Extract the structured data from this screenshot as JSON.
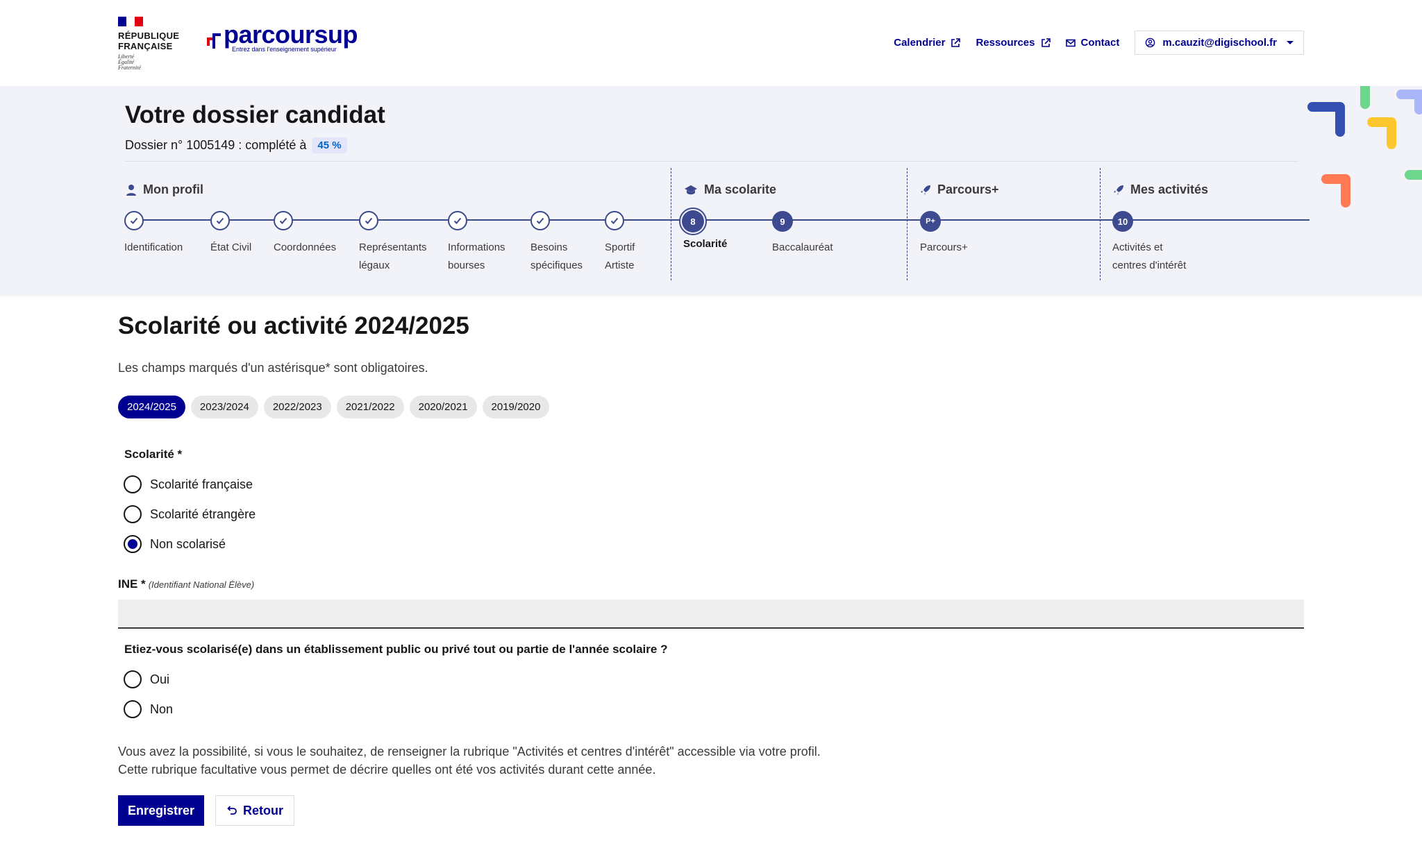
{
  "header": {
    "republique": "RÉPUBLIQUE\nFRANÇAISE",
    "devise": "Liberté\nÉgalité\nFraternité",
    "logo_word": "parcoursup",
    "logo_tagline": "Entrez dans l'enseignement supérieur",
    "nav": {
      "calendrier": "Calendrier",
      "ressources": "Ressources",
      "contact": "Contact",
      "user": "m.cauzit@digischool.fr"
    },
    "colors": {
      "brand": "#000091",
      "flag_blue": "#000091",
      "flag_red": "#e1000f"
    }
  },
  "dossier": {
    "title": "Votre dossier candidat",
    "subtitle": "Dossier n° 1005149 : complété à",
    "percent": "45 %",
    "sections": {
      "profil": "Mon profil",
      "scolarite": "Ma scolarite",
      "parcours": "Parcours+",
      "activites": "Mes activités"
    },
    "steps": {
      "identification": "Identification",
      "etat_civil": "État Civil",
      "coordonnees": "Coordonnées",
      "representants": "Représentants\nlégaux",
      "bourses": "Informations\nbourses",
      "besoins": "Besoins\nspécifiques",
      "sportif": "Sportif\nArtiste",
      "scolarite": "Scolarité",
      "scolarite_num": "8",
      "bac": "Baccalauréat",
      "bac_num": "9",
      "parcours": "Parcours+",
      "parcours_num": "P+",
      "activites": "Activités et\ncentres d'intérêt",
      "activites_num": "10"
    }
  },
  "form": {
    "title": "Scolarité ou activité 2024/2025",
    "required_note": "Les champs marqués d'un astérisque* sont obligatoires.",
    "years": [
      "2024/2025",
      "2023/2024",
      "2022/2023",
      "2021/2022",
      "2020/2021",
      "2019/2020"
    ],
    "scolarite_label": "Scolarité *",
    "scolarite_options": [
      "Scolarité française",
      "Scolarité étrangère",
      "Non scolarisé"
    ],
    "ine_label": "INE *",
    "ine_hint": "(Identifiant National Élève)",
    "ine_value": "",
    "etab_question": "Etiez-vous scolarisé(e) dans un établissement public ou privé tout ou partie de l'année scolaire ?",
    "etab_options": [
      "Oui",
      "Non"
    ],
    "info_line1": "Vous avez la possibilité, si vous le souhaitez, de renseigner la rubrique \"Activités et centres d'intérêt\" accessible via votre profil.",
    "info_line2": "Cette rubrique facultative vous permet de décrire quelles ont été vos activités durant cette année.",
    "save_label": "Enregistrer",
    "back_label": "Retour"
  }
}
